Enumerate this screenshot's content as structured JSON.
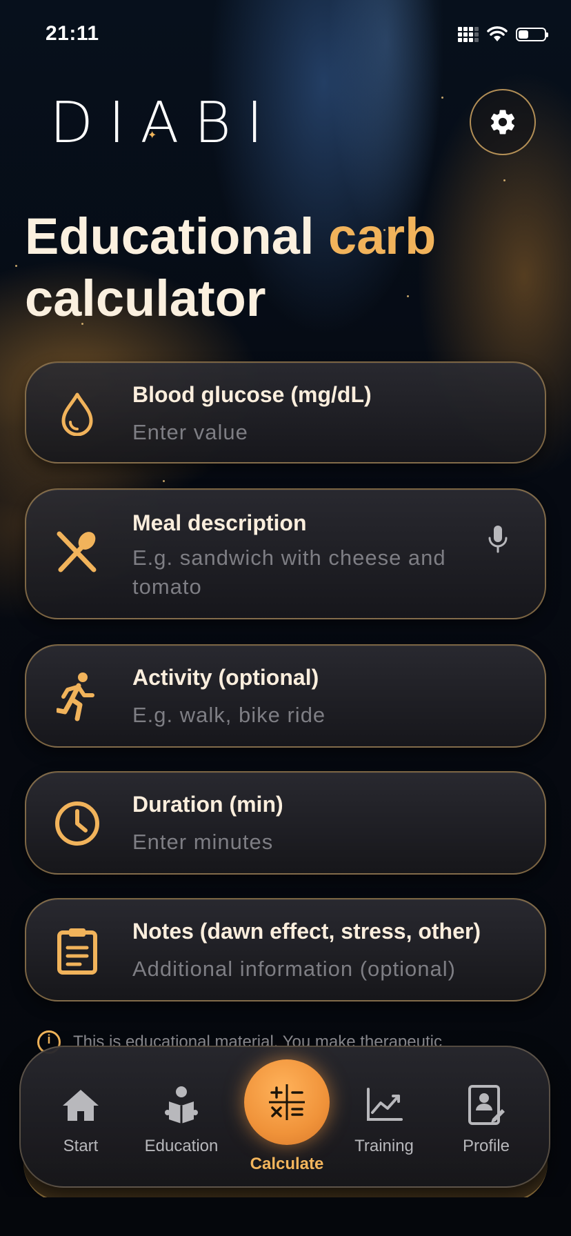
{
  "status_bar": {
    "time": "21:11"
  },
  "header": {
    "logo": "DIABI"
  },
  "page": {
    "title_part1": "Educational",
    "title_accent": "carb",
    "title_part2": "calculator"
  },
  "fields": {
    "blood_glucose": {
      "label": "Blood glucose (mg/dL)",
      "placeholder": "Enter value",
      "icon": "drop-icon"
    },
    "meal_description": {
      "label": "Meal description",
      "placeholder": "E.g. sandwich with cheese and tomato",
      "icon": "fork-spoon-icon",
      "action_icon": "microphone-icon"
    },
    "activity": {
      "label": "Activity (optional)",
      "placeholder": "E.g. walk, bike ride",
      "icon": "running-icon"
    },
    "duration": {
      "label": "Duration (min)",
      "placeholder": "Enter minutes",
      "icon": "clock-icon"
    },
    "notes": {
      "label": "Notes (dawn effect, stress, other)",
      "placeholder": "Additional information (optional)",
      "icon": "clipboard-icon"
    }
  },
  "disclaimer": {
    "text": "This is educational material. You make therapeutic"
  },
  "nav": {
    "items": [
      {
        "label": "Start",
        "icon": "home-icon"
      },
      {
        "label": "Education",
        "icon": "reading-person-icon"
      },
      {
        "label": "Calculate",
        "icon": "calculator-icon",
        "active": true
      },
      {
        "label": "Training",
        "icon": "line-chart-icon"
      },
      {
        "label": "Profile",
        "icon": "profile-icon"
      }
    ]
  },
  "colors": {
    "accent": "#f1b35b",
    "background": "#05070d",
    "card_border": "#cea462",
    "calc_button": "#f0933a",
    "placeholder": "#7e7e84"
  }
}
